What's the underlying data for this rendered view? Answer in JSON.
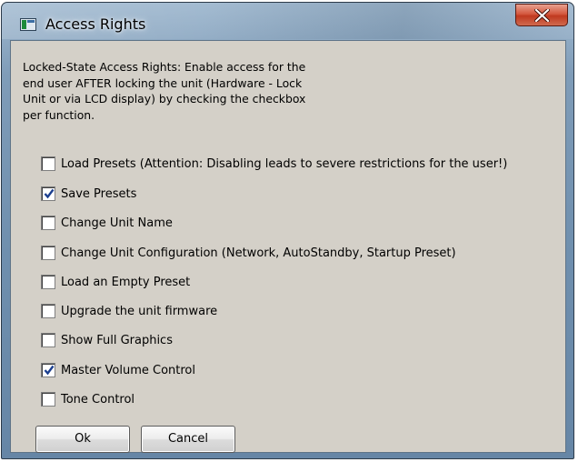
{
  "window": {
    "title": "Access Rights"
  },
  "description": "Locked-State Access Rights: Enable access for the\nend user AFTER locking the unit (Hardware - Lock\nUnit or via LCD display) by checking the checkbox\nper function.",
  "options": [
    {
      "label": "Load Presets (Attention: Disabling leads to severe restrictions for the user!)",
      "checked": false
    },
    {
      "label": "Save Presets",
      "checked": true
    },
    {
      "label": "Change Unit Name",
      "checked": false
    },
    {
      "label": "Change Unit Configuration (Network, AutoStandby, Startup Preset)",
      "checked": false
    },
    {
      "label": "Load an Empty Preset",
      "checked": false
    },
    {
      "label": "Upgrade the unit firmware",
      "checked": false
    },
    {
      "label": "Show Full Graphics",
      "checked": false
    },
    {
      "label": "Master Volume Control",
      "checked": true
    },
    {
      "label": "Tone Control",
      "checked": false
    }
  ],
  "buttons": {
    "ok_label": "Ok",
    "cancel_label": "Cancel"
  },
  "colors": {
    "titlebar": "#7f9cb8",
    "close_button": "#c0391f",
    "client_background": "#d4d0c8",
    "check_mark": "#1c3f8f"
  },
  "icons": {
    "app": "app-window-icon",
    "close": "close-x-icon",
    "check": "check-mark-icon"
  }
}
